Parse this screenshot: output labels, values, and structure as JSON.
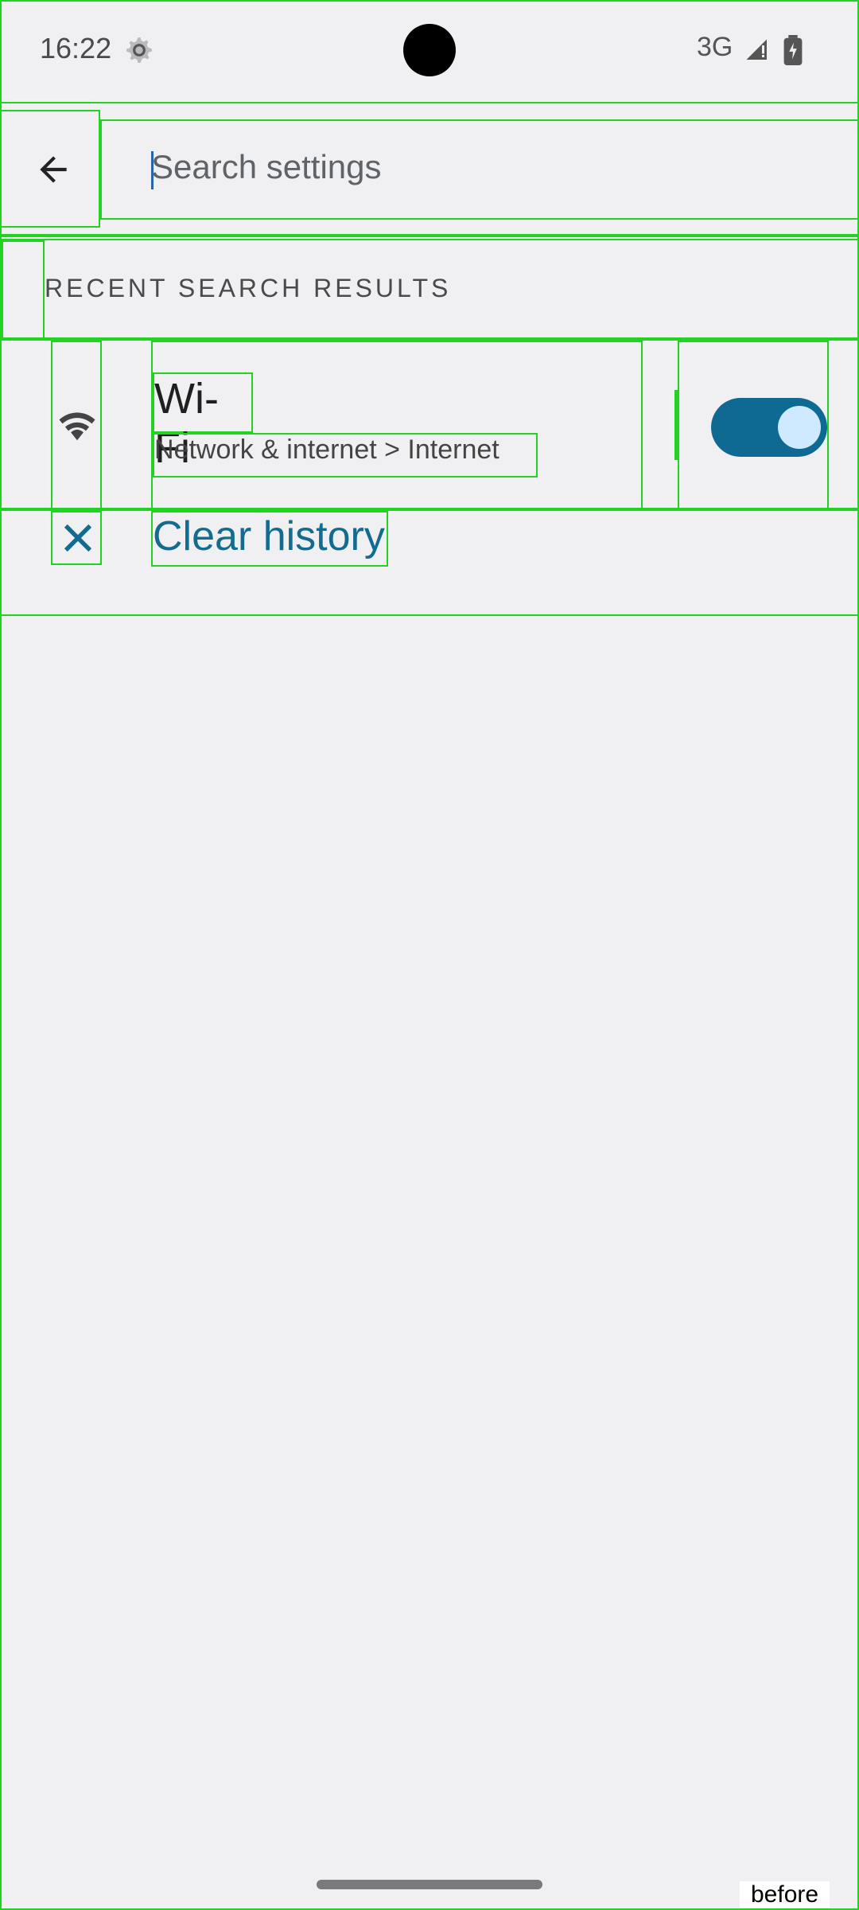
{
  "status_bar": {
    "time": "16:22",
    "network": "3G"
  },
  "search": {
    "placeholder": "Search settings"
  },
  "sections": {
    "recent_title": "RECENT SEARCH RESULTS"
  },
  "result_item": {
    "title": "Wi-Fi",
    "subtitle": "Network & internet > Internet",
    "toggle_on": true
  },
  "actions": {
    "clear_history": "Clear history"
  },
  "footer_label": "before",
  "colors": {
    "background": "#f0f0f3",
    "accent": "#136b8f",
    "toggle_track": "#0e6a92",
    "toggle_thumb": "#cfeafe"
  }
}
